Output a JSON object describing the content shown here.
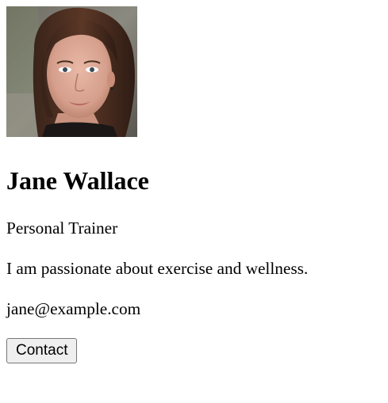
{
  "profile": {
    "name": "Jane Wallace",
    "title": "Personal Trainer",
    "bio": "I am passionate about exercise and wellness.",
    "email": "jane@example.com",
    "avatar_icon": "profile-photo"
  },
  "actions": {
    "contact_label": "Contact"
  }
}
